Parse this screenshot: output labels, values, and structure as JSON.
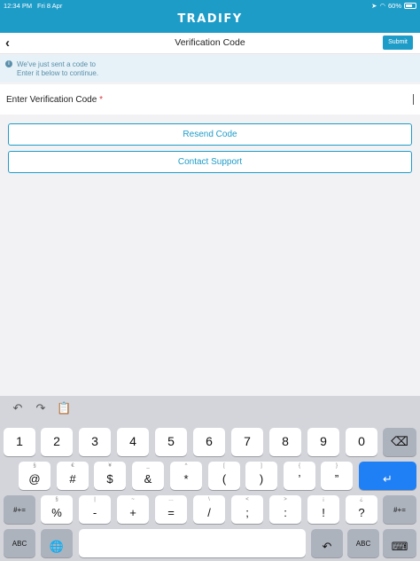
{
  "status_bar": {
    "time": "12:34 PM",
    "date": "Fri 8 Apr",
    "battery": "60%"
  },
  "brand": "TRADIFY",
  "nav": {
    "back_glyph": "‹",
    "title": "Verification Code",
    "submit_label": "Submit"
  },
  "info": {
    "line1": "We've just sent a code to",
    "line2": "Enter it below to continue."
  },
  "field": {
    "label": "Enter Verification Code",
    "required_mark": "*"
  },
  "actions": {
    "resend": "Resend Code",
    "contact": "Contact Support"
  },
  "keyboard": {
    "tools": {
      "undo": "↶",
      "redo": "↷",
      "paste": "📋"
    },
    "row1": [
      "1",
      "2",
      "3",
      "4",
      "5",
      "6",
      "7",
      "8",
      "9",
      "0"
    ],
    "row1_delete": "⌫",
    "row2": [
      {
        "sub": "§",
        "main": "@"
      },
      {
        "sub": "€",
        "main": "#"
      },
      {
        "sub": "¥",
        "main": "$"
      },
      {
        "sub": "_",
        "main": "&"
      },
      {
        "sub": "^",
        "main": "*"
      },
      {
        "sub": "[",
        "main": "("
      },
      {
        "sub": "]",
        "main": ")"
      },
      {
        "sub": "{",
        "main": "’"
      },
      {
        "sub": "}",
        "main": "”"
      }
    ],
    "return_glyph": "↵",
    "row3_left": "#+=",
    "row3": [
      {
        "sub": "§",
        "main": "%"
      },
      {
        "sub": "|",
        "main": "-"
      },
      {
        "sub": "~",
        "main": "+"
      },
      {
        "sub": "…",
        "main": "="
      },
      {
        "sub": "\\",
        "main": "/"
      },
      {
        "sub": "<",
        "main": ";"
      },
      {
        "sub": ">",
        "main": ":"
      },
      {
        "sub": "¡",
        "main": "!"
      },
      {
        "sub": "¿",
        "main": "?"
      }
    ],
    "row3_right": "#+=",
    "abc_left": "ABC",
    "globe_glyph": "🌐",
    "undo_key": "↶",
    "abc_right": "ABC",
    "hide_glyph": "⌨"
  }
}
